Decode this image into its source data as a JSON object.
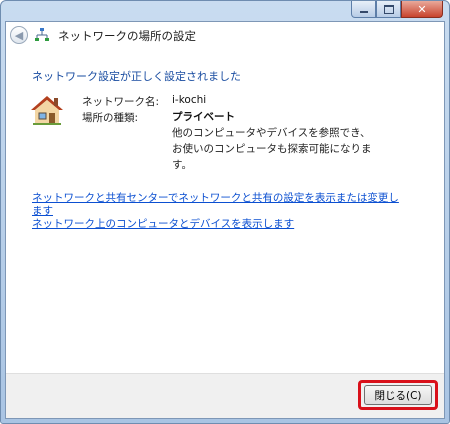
{
  "window": {
    "title": "ネットワークの場所の設定",
    "caption_buttons": {
      "minimize": "minimize",
      "maximize": "maximize",
      "close": "close"
    }
  },
  "status": {
    "heading": "ネットワーク設定が正しく設定されました"
  },
  "info": {
    "network_name_label": "ネットワーク名:",
    "network_name_value": "i-kochi",
    "location_type_label": "場所の種類:",
    "location_type_value": "プライベート",
    "description_line1": "他のコンピュータやデバイスを参照でき、",
    "description_line2": "お使いのコンピュータも探索可能になりま",
    "description_line3": "す。"
  },
  "links": {
    "network_center_line1": "ネットワークと共有センターでネットワークと共有の設定を表示または変更し",
    "network_center_line2": "ます",
    "view_computers": "ネットワーク上のコンピュータとデバイスを表示します"
  },
  "footer": {
    "close_label": "閉じる(C)"
  },
  "colors": {
    "heading": "#1a4da1",
    "link": "#0b4fd1",
    "highlight": "#d9101a"
  },
  "icons": {
    "back": "back-arrow-icon",
    "network": "network-icon",
    "house": "house-icon"
  }
}
